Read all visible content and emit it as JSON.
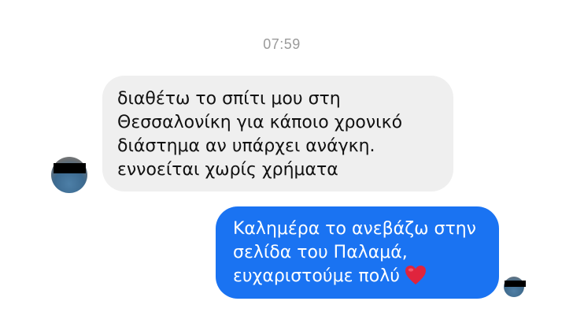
{
  "conversation": {
    "timestamp": "07:59",
    "messages": [
      {
        "sender": "other",
        "lines": [
          "διαθέτω το σπίτι μου στη",
          "Θεσσαλονίκη για κάποιο χρονικό",
          "διάστημα αν υπάρχει ανάγκη.",
          "εννοείται χωρίς χρήματα"
        ],
        "avatar_redacted": true
      },
      {
        "sender": "self",
        "lines": [
          "Καλημέρα το ανεβάζω στην",
          "σελίδα του Παλαμά,",
          "ευχαριστούμε πολύ"
        ],
        "emoji": "red-heart-icon",
        "avatar_redacted": true
      }
    ]
  },
  "colors": {
    "incoming_bubble": "#efefef",
    "outgoing_bubble": "#1a73f2",
    "timestamp_text": "#9a9a9a",
    "heart": "#e0243d"
  }
}
